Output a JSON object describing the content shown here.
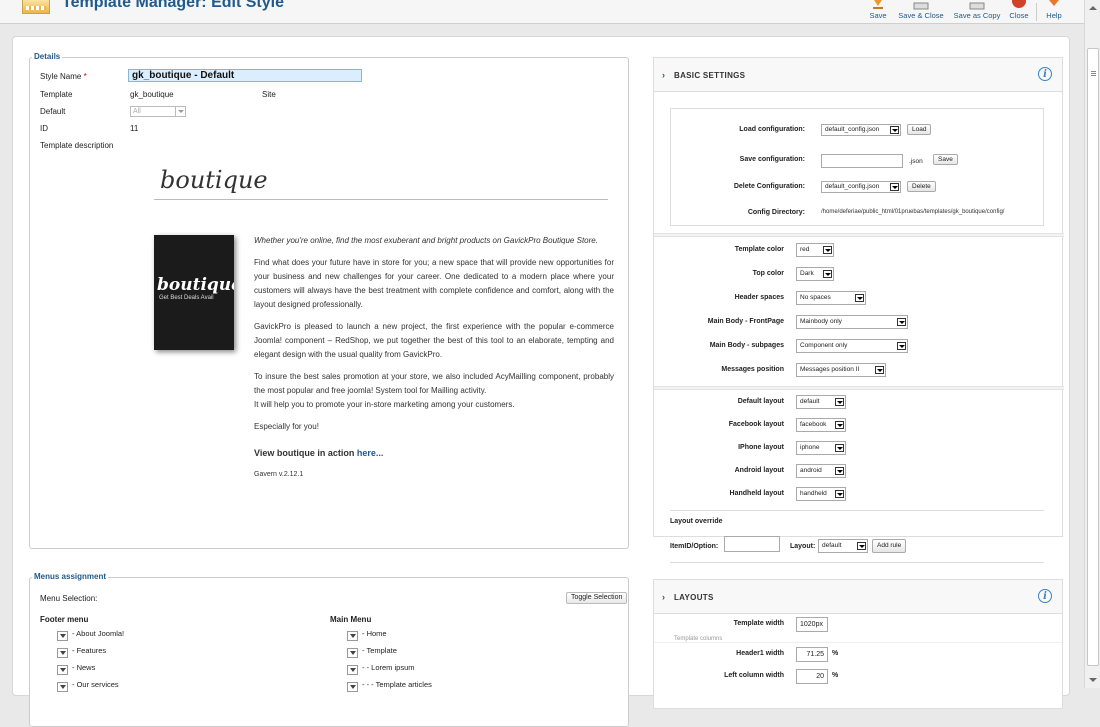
{
  "header": {
    "title": "Template Manager: Edit Style",
    "toolbar": [
      {
        "label": "Save",
        "icon": "save-icon"
      },
      {
        "label": "Save & Close",
        "icon": "save-close-icon"
      },
      {
        "label": "Save as Copy",
        "icon": "save-copy-icon"
      },
      {
        "label": "Close",
        "icon": "close-icon"
      },
      {
        "label": "Help",
        "icon": "help-icon"
      }
    ]
  },
  "details": {
    "legend": "Details",
    "style_name_label": "Style Name",
    "required_mark": "*",
    "style_name_value": "gk_boutique - Default",
    "template_label": "Template",
    "template_value": "gk_boutique",
    "client_value": "Site",
    "default_label": "Default",
    "default_value": "All",
    "id_label": "ID",
    "id_value": "11",
    "desc_label": "Template description",
    "template_title": "boutique",
    "thumb_title": "boutique",
    "thumb_subtitle": "Get Best Deals Avail",
    "desc_p1": "Whether you're online, find the most exuberant and bright products on GavickPro Boutique Store.",
    "desc_p2": "Find what does your future have in store for you; a new space that will provide new opportunities for your business and new challenges for your career. One dedicated to a modern place where your customers will always have the best treatment with complete confidence and comfort, along with the layout designed professionally.",
    "desc_p3": "GavickPro is pleased to launch a new project, the first experience with the popular e-commerce Joomla! component – RedShop, we put together the best of this tool to an elaborate, tempting and elegant design with the usual quality from GavickPro.",
    "desc_p4a": "To insure the best sales promotion at your store, we also included AcyMailling component, probably the most popular and free joomla! System tool for Mailling activity.",
    "desc_p4b": "It will help you to promote your in-store marketing among your customers.",
    "desc_p5": "Especially for you!",
    "view_text": "View boutique in action",
    "view_link": "here...",
    "version": "Gavern v.2.12.1"
  },
  "menus": {
    "legend": "Menus assignment",
    "selection_label": "Menu Selection:",
    "toggle_label": "Toggle Selection",
    "footer_title": "Footer menu",
    "footer_items": [
      "- About Joomla!",
      "- Features",
      "- News",
      "- Our services"
    ],
    "main_title": "Main Menu",
    "main_items": [
      "- Home",
      "- Template",
      "- - Lorem ipsum",
      "- - - Template articles"
    ]
  },
  "basic": {
    "title": "BASIC SETTINGS",
    "load_label": "Load configuration:",
    "load_value": "default_config.json",
    "load_btn": "Load",
    "save_label": "Save configuration:",
    "save_suffix": ".json",
    "save_btn": "Save",
    "delete_label": "Delete Configuration:",
    "delete_value": "default_config.json",
    "delete_btn": "Delete",
    "dir_label": "Config Directory:",
    "dir_value": "/home/deferiae/public_html/01pruebas/templates/gk_boutique/config/",
    "fields": [
      {
        "label": "Template color",
        "value": "red"
      },
      {
        "label": "Top color",
        "value": "Dark"
      },
      {
        "label": "Header spaces",
        "value": "No spaces"
      },
      {
        "label": "Main Body - FrontPage",
        "value": "Mainbody only"
      },
      {
        "label": "Main Body - subpages",
        "value": "Component only"
      },
      {
        "label": "Messages position",
        "value": "Messages position II"
      }
    ],
    "layout_fields": [
      {
        "label": "Default layout",
        "value": "default"
      },
      {
        "label": "Facebook layout",
        "value": "facebook"
      },
      {
        "label": "IPhone layout",
        "value": "iphone"
      },
      {
        "label": "Android layout",
        "value": "android"
      },
      {
        "label": "Handheld layout",
        "value": "handheld"
      }
    ],
    "override_label": "Layout override",
    "itemid_label": "ItemID/Option:",
    "layout_label": "Layout:",
    "layout_value": "default",
    "add_rule": "Add rule"
  },
  "layouts": {
    "title": "LAYOUTS",
    "template_width_label": "Template width",
    "template_width_value": "1020px",
    "template_columns_label": "Template columns",
    "header1_label": "Header1 width",
    "header1_value": "71.25",
    "left_col_label": "Left column width",
    "left_col_value": "20",
    "percent": "%"
  },
  "colors": {
    "accent": "#215a8c",
    "required": "#cc0000",
    "input_focus": "#dbeeff"
  }
}
